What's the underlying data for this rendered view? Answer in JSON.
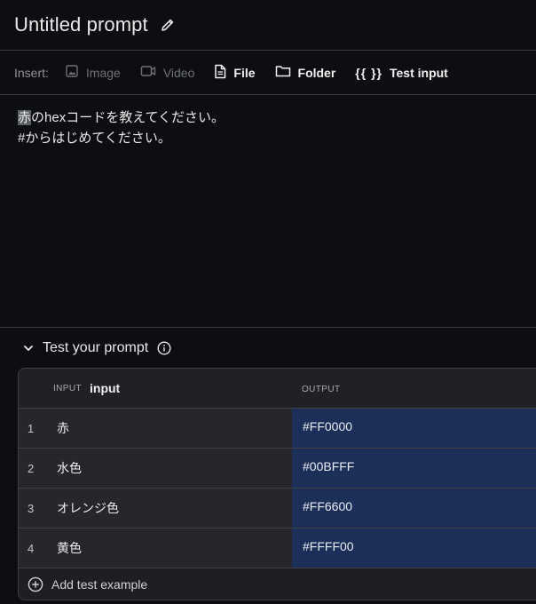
{
  "header": {
    "title": "Untitled prompt",
    "edit_icon": "pencil-icon"
  },
  "toolbar": {
    "insert_label": "Insert:",
    "items": [
      {
        "label": "Image",
        "icon": "image-icon",
        "enabled": false
      },
      {
        "label": "Video",
        "icon": "video-icon",
        "enabled": false
      },
      {
        "label": "File",
        "icon": "file-icon",
        "enabled": true
      },
      {
        "label": "Folder",
        "icon": "folder-icon",
        "enabled": true
      },
      {
        "label": "Test input",
        "icon": "braces-icon",
        "enabled": true
      }
    ]
  },
  "editor": {
    "line1_selected": "赤",
    "line1_rest": "のhexコードを教えてください。",
    "line2": "#からはじめてください。"
  },
  "test": {
    "title": "Test your prompt",
    "info_icon": "info-icon",
    "columns": {
      "input_small": "INPUT",
      "input_name": "input",
      "output": "OUTPUT"
    },
    "rows": [
      {
        "num": "1",
        "input": "赤",
        "output": "#FF0000"
      },
      {
        "num": "2",
        "input": "水色",
        "output": "#00BFFF"
      },
      {
        "num": "3",
        "input": "オレンジ色",
        "output": "#FF6600"
      },
      {
        "num": "4",
        "input": "黄色",
        "output": "#FFFF00"
      }
    ],
    "add_label": "Add test example"
  },
  "colors": {
    "background": "#0d0e12",
    "output_cell": "#1c2f58",
    "border": "#3a3b40"
  }
}
